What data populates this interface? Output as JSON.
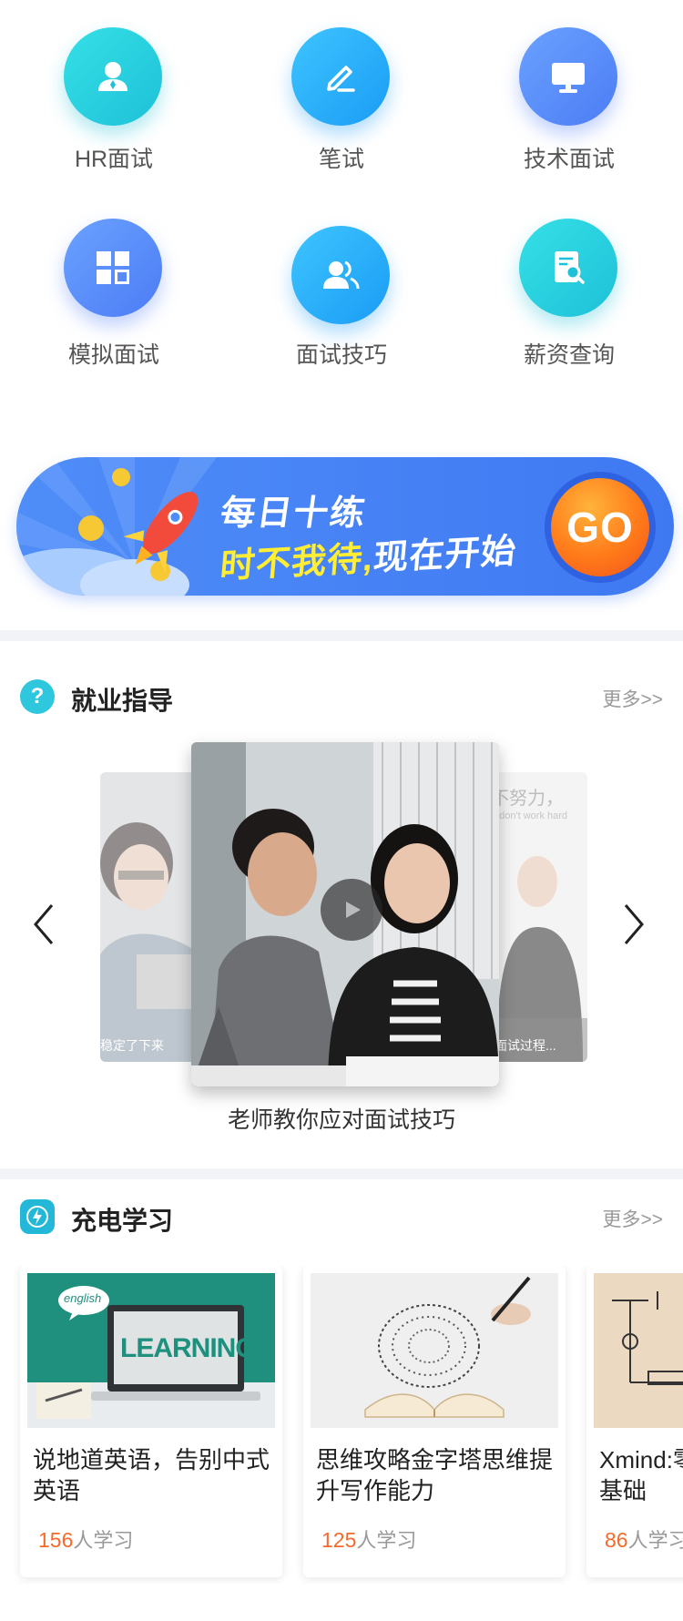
{
  "grid": {
    "items": [
      {
        "label": "HR面试",
        "icon": "user-icon"
      },
      {
        "label": "笔试",
        "icon": "pencil-icon"
      },
      {
        "label": "技术面试",
        "icon": "monitor-icon"
      },
      {
        "label": "模拟面试",
        "icon": "grid-icon"
      },
      {
        "label": "面试技巧",
        "icon": "people-icon"
      },
      {
        "label": "薪资查询",
        "icon": "document-search-icon"
      }
    ]
  },
  "banner": {
    "title1": "每日十练",
    "title2_highlight": "时不我待,",
    "title2_rest": "现在开始",
    "go_label": "GO"
  },
  "guidance": {
    "title": "就业指导",
    "more": "更多>>",
    "left_caption": "稳定了下来",
    "right_overlay": "不努力，",
    "right_overlay_en": "u don't work hard",
    "right_caption": "面试过程...",
    "caption": "老师教你应对面试技巧"
  },
  "study": {
    "title": "充电学习",
    "more": "更多>>",
    "courses": [
      {
        "title": "说地道英语，告别中式英语",
        "count": "156",
        "suffix": "人学习",
        "thumb_text": "LEARNING",
        "bubble": "english"
      },
      {
        "title": "思维攻略金字塔思维提升写作能力",
        "count": "125",
        "suffix": "人学习"
      },
      {
        "title": "Xmind:零基础",
        "count": "86",
        "suffix": "人学习"
      }
    ]
  },
  "colors": {
    "accent": "#3f79f2",
    "count": "#f36a2a",
    "cyan": "#1ec1d8"
  }
}
